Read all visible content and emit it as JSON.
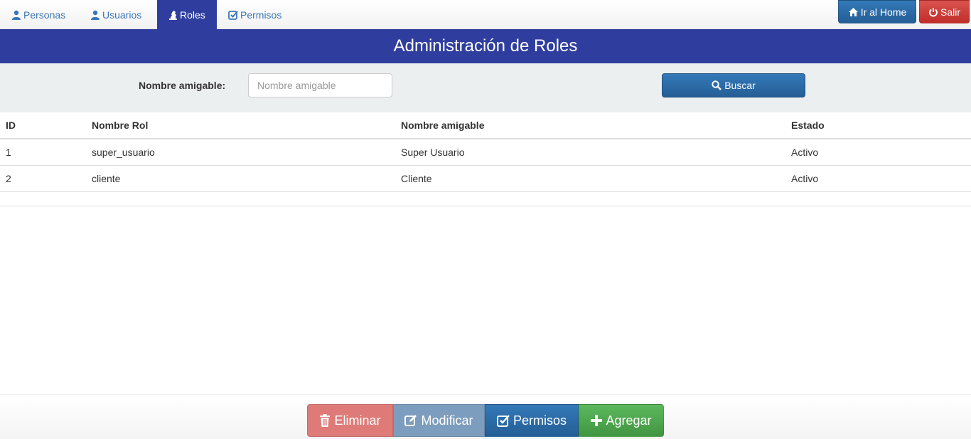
{
  "nav": {
    "tabs": [
      {
        "label": "Personas",
        "icon": "user-icon",
        "active": false
      },
      {
        "label": "Usuarios",
        "icon": "user-icon",
        "active": false
      },
      {
        "label": "Roles",
        "icon": "chess-knight-icon",
        "active": true
      },
      {
        "label": "Permisos",
        "icon": "check-square-icon",
        "active": false
      }
    ],
    "home_label": "Ir al Home",
    "logout_label": "Salir"
  },
  "header": {
    "title": "Administración de Roles"
  },
  "search": {
    "label": "Nombre amigable:",
    "placeholder": "Nombre amigable",
    "value": "",
    "button_label": "Buscar"
  },
  "table": {
    "columns": [
      "ID",
      "Nombre Rol",
      "Nombre amigable",
      "Estado"
    ],
    "rows": [
      [
        "1",
        "super_usuario",
        "Super Usuario",
        "Activo"
      ],
      [
        "2",
        "cliente",
        "Cliente",
        "Activo"
      ]
    ]
  },
  "actions": {
    "delete_label": "Eliminar",
    "edit_label": "Modificar",
    "permissions_label": "Permisos",
    "add_label": "Agregar"
  },
  "colors": {
    "brand": "#2f3e9e",
    "primary": "#255e96",
    "danger": "#c12e2a",
    "success": "#419641"
  }
}
